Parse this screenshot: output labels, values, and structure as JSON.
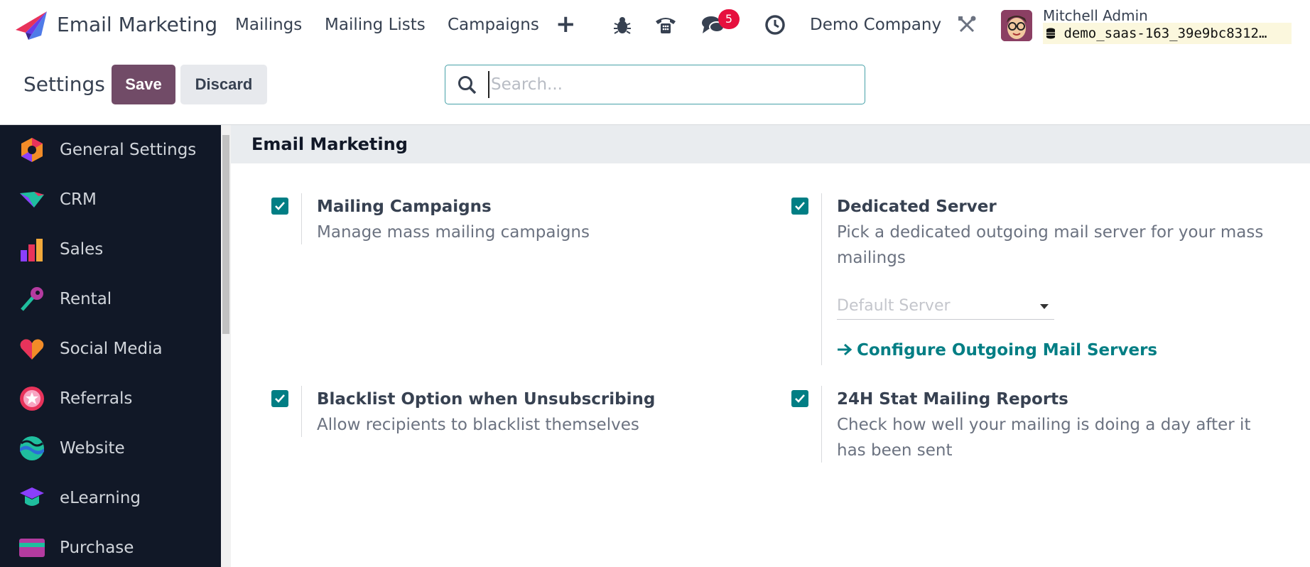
{
  "navbar": {
    "app_name": "Email Marketing",
    "menu": [
      "Mailings",
      "Mailing Lists",
      "Campaigns"
    ],
    "plus": "+",
    "messages_badge": "5",
    "company": "Demo Company",
    "user_name": "Mitchell Admin",
    "database": "demo_saas-163_39e9bc8312…"
  },
  "control_panel": {
    "title": "Settings",
    "save_label": "Save",
    "discard_label": "Discard",
    "search_placeholder": "Search..."
  },
  "sidebar": {
    "items": [
      {
        "label": "General Settings",
        "icon": "general-settings-icon"
      },
      {
        "label": "CRM",
        "icon": "crm-icon"
      },
      {
        "label": "Sales",
        "icon": "sales-icon"
      },
      {
        "label": "Rental",
        "icon": "rental-icon"
      },
      {
        "label": "Social Media",
        "icon": "social-media-icon"
      },
      {
        "label": "Referrals",
        "icon": "referrals-icon"
      },
      {
        "label": "Website",
        "icon": "website-icon"
      },
      {
        "label": "eLearning",
        "icon": "elearning-icon"
      },
      {
        "label": "Purchase",
        "icon": "purchase-icon"
      }
    ]
  },
  "section": {
    "title": "Email Marketing",
    "options": [
      {
        "title": "Mailing Campaigns",
        "desc": "Manage mass mailing campaigns",
        "checked": true
      },
      {
        "title": "Dedicated Server",
        "desc": "Pick a dedicated outgoing mail server for your mass mailings",
        "checked": true
      },
      {
        "title": "Blacklist Option when Unsubscribing",
        "desc": "Allow recipients to blacklist themselves",
        "checked": true
      },
      {
        "title": "24H Stat Mailing Reports",
        "desc": "Check how well your mailing is doing a day after it has been sent",
        "checked": true
      }
    ],
    "server_select_placeholder": "Default Server",
    "configure_link": "Configure Outgoing Mail Servers"
  },
  "colors": {
    "primary": "#714b67",
    "accent": "#017e84",
    "sidebar_bg": "#111827",
    "badge": "#e6103e"
  }
}
